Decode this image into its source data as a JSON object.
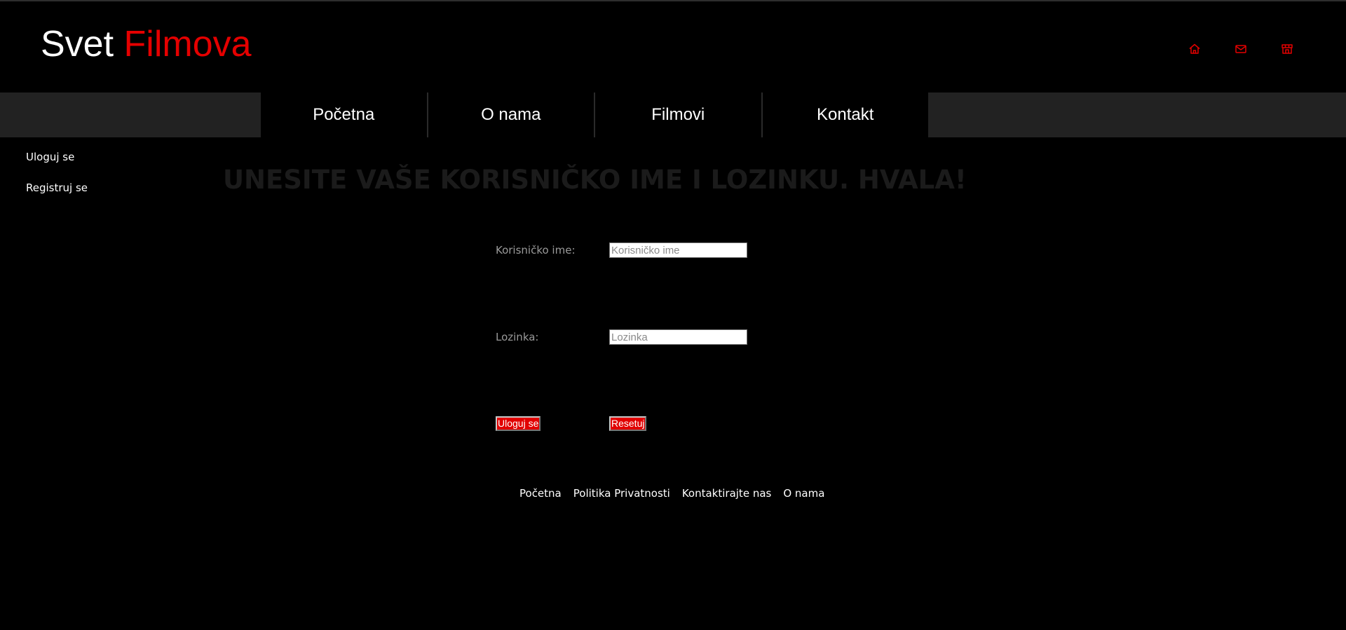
{
  "brand": {
    "first": "Svet",
    "second": "Filmova"
  },
  "header_icons": [
    {
      "icon": "home-icon",
      "color": "#e50000"
    },
    {
      "icon": "mail-icon",
      "color": "#e50000"
    },
    {
      "icon": "store-icon",
      "color": "#e50000"
    }
  ],
  "nav": {
    "items": [
      "Početna",
      "O nama",
      "Filmovi",
      "Kontakt"
    ]
  },
  "sidebar": {
    "items": [
      "Uloguj se",
      "Registruj se"
    ]
  },
  "main": {
    "heading": "UNESITE VAŠE KORISNIČKO IME I LOZINKU. HVALA!"
  },
  "form": {
    "username_label": "Korisničko ime:",
    "username_placeholder": "Korisničko ime",
    "username_value": "",
    "password_label": "Lozinka:",
    "password_placeholder": "Lozinka",
    "password_value": "",
    "submit_label": "Uloguj se",
    "reset_label": "Resetuj"
  },
  "footer": {
    "links": [
      "Početna",
      "Politika Privatnosti",
      "Kontaktirajte nas",
      "O nama"
    ]
  },
  "colors": {
    "background": "#000000",
    "accent": "#e50000",
    "nav_bar": "#222222",
    "heading": "#1b1b1b"
  }
}
